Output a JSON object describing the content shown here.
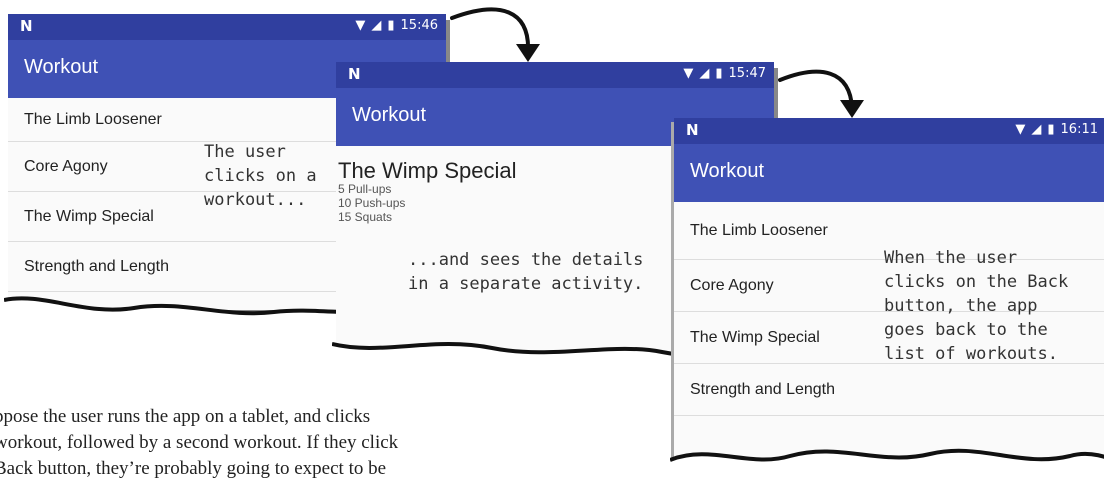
{
  "phone1": {
    "time": "15:46",
    "title": "Workout",
    "items": [
      "The Limb Loosener",
      "Core Agony",
      "The Wimp Special",
      "Strength and Length"
    ],
    "note": "The user\nclicks on a\nworkout..."
  },
  "phone2": {
    "time": "15:47",
    "title": "Workout",
    "detail_title": "The Wimp Special",
    "detail_lines": [
      "5 Pull-ups",
      "10 Push-ups",
      "15 Squats"
    ],
    "note": "...and sees the details\nin a separate activity."
  },
  "phone3": {
    "time": "16:11",
    "title": "Workout",
    "items": [
      "The Limb Loosener",
      "Core Agony",
      "The Wimp Special",
      "Strength and Length"
    ],
    "note": "When the user\nclicks on the Back\nbutton, the app\ngoes back to the\nlist of workouts."
  },
  "body_text": "ppose the user runs the app on a tablet, and clicks\nworkout, followed by a second workout. If they click\nBack button, they’re probably going to expect to be",
  "colors": {
    "status": "#303F9F",
    "appbar": "#3F51B5"
  },
  "icons": {
    "logo": "n-logo-icon",
    "wifi": "wifi-icon",
    "signal": "signal-icon",
    "battery": "battery-icon"
  }
}
